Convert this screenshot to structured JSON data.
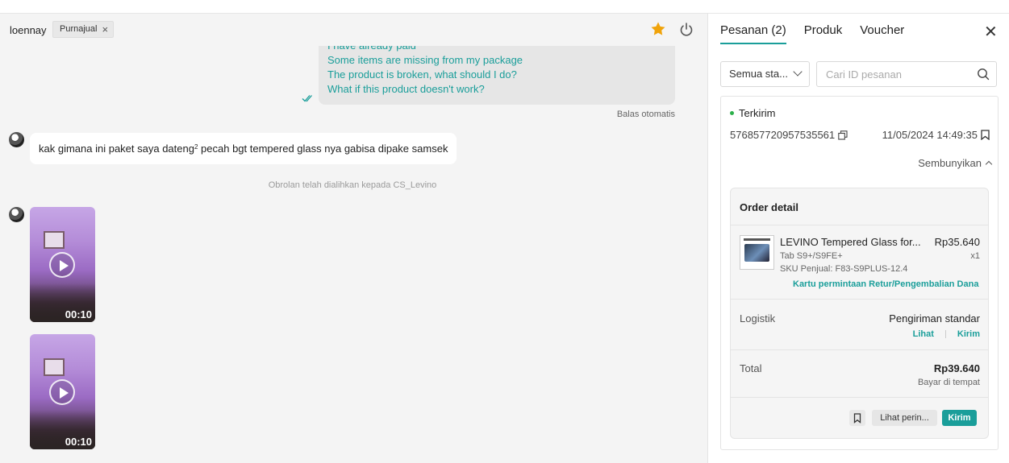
{
  "chat": {
    "username": "loennay",
    "tag_label": "Purnajual",
    "outgoing_lines": [
      "I have already paid",
      "Some items are missing from my package",
      "The product is broken, what should I do?",
      "What if this product doesn't work?"
    ],
    "auto_reply_label": "Balas otomatis",
    "incoming_message_prefix": "kak gimana ini paket saya dateng",
    "incoming_message_sup": "2",
    "incoming_message_suffix": " pecah bgt tempered glass nya gabisa dipake samsek",
    "system_note": "Obrolan telah dialihkan kepada CS_Levino",
    "videos": [
      {
        "duration": "00:10"
      },
      {
        "duration": "00:10"
      }
    ]
  },
  "panel": {
    "tabs": [
      {
        "label": "Pesanan (2)",
        "active": true
      },
      {
        "label": "Produk",
        "active": false
      },
      {
        "label": "Voucher",
        "active": false
      }
    ],
    "status_filter": "Semua sta...",
    "search_placeholder": "Cari ID pesanan",
    "order": {
      "status": "Terkirim",
      "order_id": "576857720957535561",
      "date": "11/05/2024 14:49:35",
      "hide_label": "Sembunyikan",
      "detail_title": "Order detail",
      "product_name": "LEVINO Tempered Glass for...",
      "product_price": "Rp35.640",
      "product_variant": "Tab S9+/S9FE+",
      "product_qty": "x1",
      "product_sku": "SKU Penjual: F83-S9PLUS-12.4",
      "return_link": "Kartu permintaan Retur/Pengembalian Dana",
      "logistics_label": "Logistik",
      "logistics_value": "Pengiriman standar",
      "logistics_view": "Lihat",
      "logistics_send": "Kirim",
      "total_label": "Total",
      "total_value": "Rp39.640",
      "payment_method": "Bayar di tempat",
      "more_button": "Lihat perin...",
      "send_button": "Kirim"
    }
  },
  "colors": {
    "accent": "#1a9e9a",
    "star": "#f0a30a",
    "status_green": "#2bb04a"
  },
  "icons": [
    "close-icon",
    "star-icon",
    "power-icon",
    "double-check-icon",
    "play-icon",
    "chevron-down-icon",
    "search-icon",
    "copy-icon",
    "bookmark-icon",
    "chevron-up-icon"
  ]
}
